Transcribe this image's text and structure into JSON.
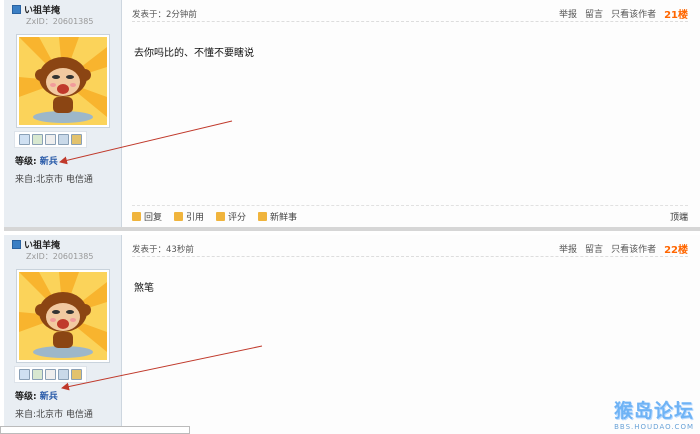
{
  "posts": [
    {
      "username": "い祖羊掩",
      "zxid": "ZxID：20601385",
      "level_label": "等级:",
      "level_value": "新兵",
      "from": "来自:北京市 电信通",
      "time": "发表于：2分钟前",
      "actions": [
        "举报",
        "留言",
        "只看该作者"
      ],
      "floor": "21楼",
      "content": "去你吗比的、不懂不要瞎说",
      "footer": [
        "回复",
        "引用",
        "评分",
        "新鲜事"
      ],
      "top_link": "顶端"
    },
    {
      "username": "い祖羊掩",
      "zxid": "ZxID：20601385",
      "level_label": "等级:",
      "level_value": "新兵",
      "from": "来自:北京市 电信通",
      "time": "发表于：43秒前",
      "actions": [
        "举报",
        "留言",
        "只看该作者"
      ],
      "floor": "22楼",
      "content": "煞笔"
    }
  ],
  "watermark": {
    "title": "猴岛论坛",
    "url": "BBS.HOUDAO.COM"
  },
  "colors": {
    "floor": "#ff6600",
    "level": "#2759a8",
    "sidebar": "#e9eef3",
    "arrow": "#c0392b"
  },
  "icons": [
    "user-icon",
    "mail-icon",
    "profile-icon",
    "doc-icon",
    "photo-icon",
    "friends-icon",
    "reply-icon",
    "quote-icon",
    "rate-icon",
    "news-icon",
    "arrow-annotation"
  ]
}
